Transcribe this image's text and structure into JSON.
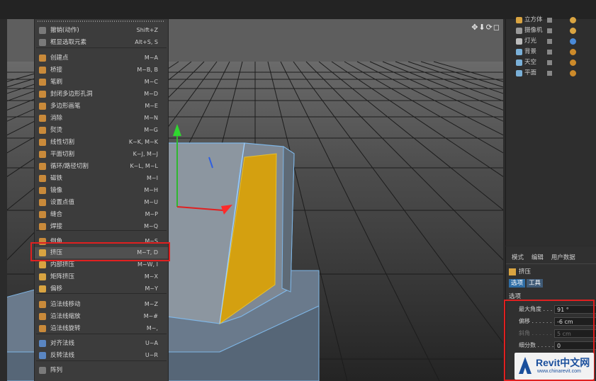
{
  "viewport": {
    "nav_icons": "✥⬇⟳◻"
  },
  "menu": {
    "items": [
      {
        "label": "撤销(动作)",
        "shortcut": "Shift+Z",
        "color": "#7a7a7a"
      },
      {
        "label": "框显选取元素",
        "shortcut": "Alt+S, S",
        "color": "#7a7a7a"
      },
      {
        "label": "创建点",
        "shortcut": "M~A",
        "color": "#c98a3a"
      },
      {
        "label": "桥接",
        "shortcut": "M~B, B",
        "color": "#c98a3a"
      },
      {
        "label": "笔刷",
        "shortcut": "M~C",
        "color": "#c98a3a"
      },
      {
        "label": "封闭多边形孔洞",
        "shortcut": "M~D",
        "color": "#c98a3a"
      },
      {
        "label": "多边形画笔",
        "shortcut": "M~E",
        "color": "#c98a3a"
      },
      {
        "label": "消除",
        "shortcut": "M~N",
        "color": "#c98a3a"
      },
      {
        "label": "熨烫",
        "shortcut": "M~G",
        "color": "#c98a3a"
      },
      {
        "label": "线性切割",
        "shortcut": "K~K, M~K",
        "color": "#c98a3a"
      },
      {
        "label": "平面切割",
        "shortcut": "K~J, M~J",
        "color": "#c98a3a"
      },
      {
        "label": "循环/路径切割",
        "shortcut": "K~L, M~L",
        "color": "#c98a3a"
      },
      {
        "label": "磁铁",
        "shortcut": "M~I",
        "color": "#c98a3a"
      },
      {
        "label": "镜像",
        "shortcut": "M~H",
        "color": "#c98a3a"
      },
      {
        "label": "设置点值",
        "shortcut": "M~U",
        "color": "#c98a3a"
      },
      {
        "label": "缝合",
        "shortcut": "M~P",
        "color": "#c98a3a"
      },
      {
        "label": "焊接",
        "shortcut": "M~Q",
        "color": "#c98a3a"
      },
      {
        "label": "倒角",
        "shortcut": "M~S",
        "color": "#c98a3a"
      },
      {
        "label": "挤压",
        "shortcut": "M~T, D",
        "color": "#d9a441"
      },
      {
        "label": "内部挤压",
        "shortcut": "M~W, I",
        "color": "#d9a441"
      },
      {
        "label": "矩阵挤压",
        "shortcut": "M~X",
        "color": "#d9a441"
      },
      {
        "label": "偏移",
        "shortcut": "M~Y",
        "color": "#d9a441"
      },
      {
        "label": "沿法线移动",
        "shortcut": "M~Z",
        "color": "#c98a3a"
      },
      {
        "label": "沿法线缩放",
        "shortcut": "M~#",
        "color": "#c98a3a"
      },
      {
        "label": "沿法线旋转",
        "shortcut": "M~,",
        "color": "#c98a3a"
      },
      {
        "label": "对齐法线",
        "shortcut": "U~A",
        "color": "#5a86c2"
      },
      {
        "label": "反转法线",
        "shortcut": "U~R",
        "color": "#5a86c2"
      },
      {
        "label": "阵列",
        "shortcut": "",
        "color": "#7a7a7a"
      }
    ]
  },
  "objects": [
    {
      "name": "立方体",
      "color": "#d9a441",
      "tag": "#d9a441"
    },
    {
      "name": "摄像机",
      "color": "#9a9a9a",
      "tag": "#d9a441"
    },
    {
      "name": "灯光",
      "color": "#bcbcbc",
      "tag": "#4a8ad8"
    },
    {
      "name": "背景",
      "color": "#7ab0d8",
      "tag": "#cc8a2a"
    },
    {
      "name": "天空",
      "color": "#7ab0d8",
      "tag": "#cc8a2a"
    },
    {
      "name": "平面",
      "color": "#7ab0d8",
      "tag": "#cc8a2a"
    }
  ],
  "attributes": {
    "tabs": [
      "模式",
      "编辑",
      "用户数据"
    ],
    "object_name": "挤压",
    "sub_tabs": [
      "选项",
      "工具"
    ],
    "section": "选项",
    "params": [
      {
        "label": "最大角度 . . . .",
        "value": "91 °",
        "dim": false
      },
      {
        "label": "偏移 . . . . . . . .",
        "value": "-6 cm",
        "dim": false
      },
      {
        "label": "斜角 . . . . . . . .",
        "value": "5 cm",
        "dim": true
      },
      {
        "label": "细分数 . . . . . .",
        "value": "0",
        "dim": false
      }
    ]
  },
  "watermark": {
    "title": "Revit中文网",
    "url": "www.chinarevit.com"
  }
}
